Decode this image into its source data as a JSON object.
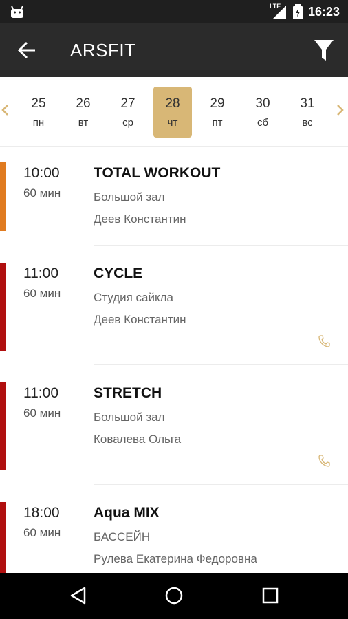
{
  "status_bar": {
    "network": "LTE",
    "time": "16:23"
  },
  "app_bar": {
    "title": "ARSFIT",
    "back_icon": "arrow-left-icon",
    "filter_icon": "filter-icon"
  },
  "date_picker": {
    "days": [
      {
        "num": "25",
        "weekday": "пн",
        "selected": false
      },
      {
        "num": "26",
        "weekday": "вт",
        "selected": false
      },
      {
        "num": "27",
        "weekday": "ср",
        "selected": false
      },
      {
        "num": "28",
        "weekday": "чт",
        "selected": true
      },
      {
        "num": "29",
        "weekday": "пт",
        "selected": false
      },
      {
        "num": "30",
        "weekday": "сб",
        "selected": false
      },
      {
        "num": "31",
        "weekday": "вс",
        "selected": false
      }
    ],
    "accent": "#d8b776"
  },
  "classes": [
    {
      "time": "10:00",
      "duration": "60 мин",
      "name": "TOTAL WORKOUT",
      "room": "Большой зал",
      "coach": "Деев Константин",
      "color": "#e07b20",
      "phone": false
    },
    {
      "time": "11:00",
      "duration": "60 мин",
      "name": "CYCLE",
      "room": "Студия сайкла",
      "coach": "Деев Константин",
      "color": "#b00f0f",
      "phone": true
    },
    {
      "time": "11:00",
      "duration": "60 мин",
      "name": "STRETCH",
      "room": "Большой зал",
      "coach": "Ковалева Ольга",
      "color": "#b00f0f",
      "phone": true
    },
    {
      "time": "18:00",
      "duration": "60 мин",
      "name": "Aqua MIX",
      "room": "БАССЕЙН",
      "coach": "Рулева Екатерина Федоровна",
      "color": "#b00f0f",
      "phone": false
    }
  ],
  "nav_bar": {
    "back": "triangle-back-icon",
    "home": "circle-home-icon",
    "recents": "square-recents-icon"
  }
}
